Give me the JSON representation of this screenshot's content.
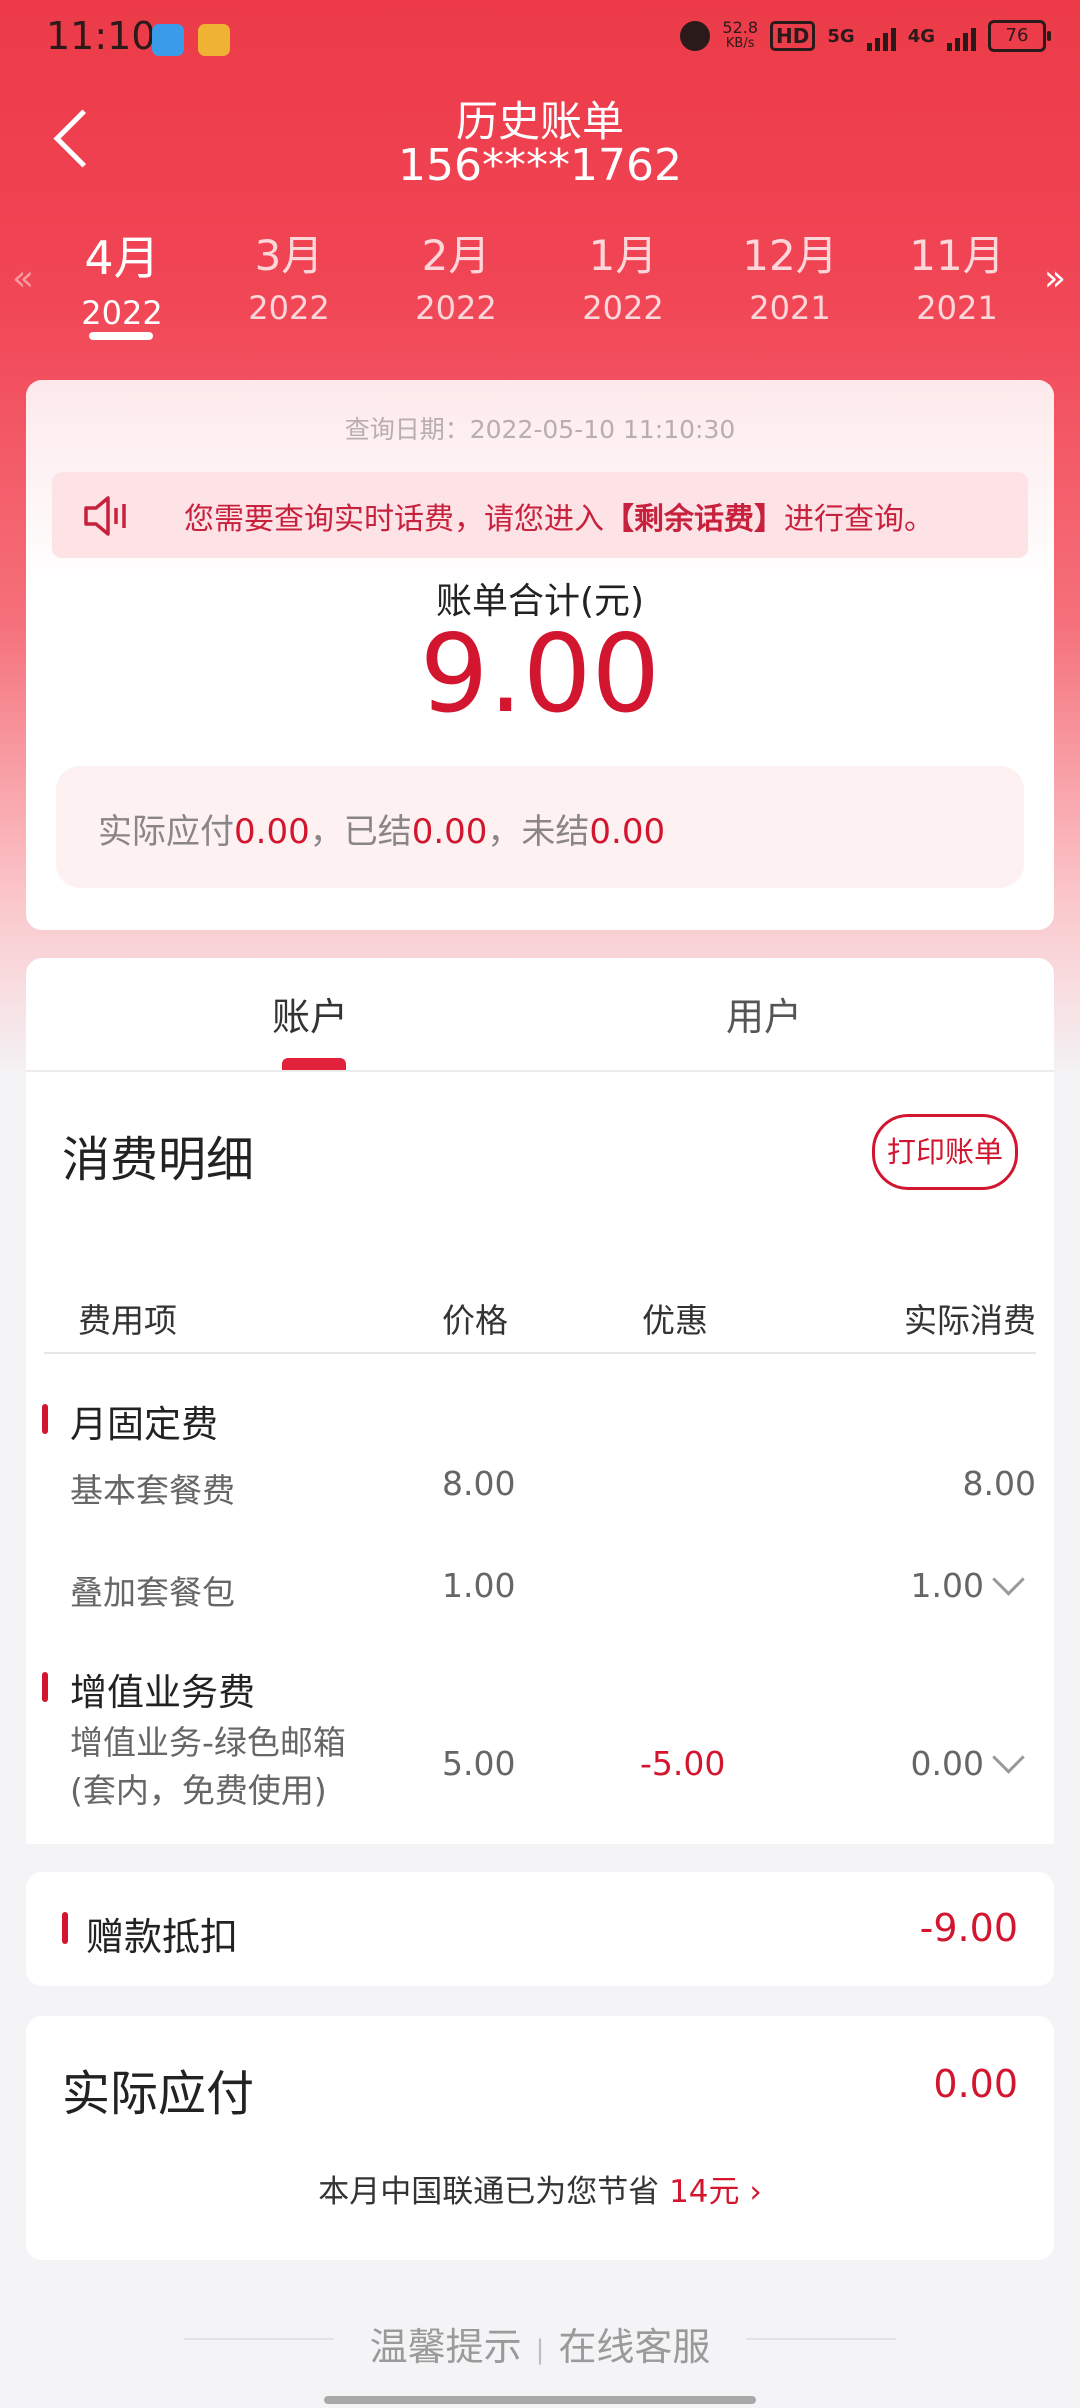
{
  "status_bar": {
    "time": "11:10",
    "net_speed_value": "52.8",
    "net_speed_unit": "KB/s",
    "hd_badge": "HD",
    "sim1_net": "5G",
    "sim2_net": "4G",
    "battery": "76"
  },
  "header": {
    "title": "历史账单",
    "phone": "156****1762"
  },
  "month_tabs": [
    {
      "month": "4月",
      "year": "2022",
      "active": true
    },
    {
      "month": "3月",
      "year": "2022"
    },
    {
      "month": "2月",
      "year": "2022"
    },
    {
      "month": "1月",
      "year": "2022"
    },
    {
      "month": "12月",
      "year": "2021"
    },
    {
      "month": "11月",
      "year": "2021"
    }
  ],
  "summary": {
    "query_date": "查询日期：2022-05-10 11:10:30",
    "notice_prefix": "您需要查询实时话费，请您进入",
    "notice_link": "【剩余话费】",
    "notice_suffix": "进行查询。",
    "total_label": "账单合计(元)",
    "total_value": "9.00",
    "actual_due_label": "实际应付",
    "actual_due_value": "0.00",
    "settled_label": "，已结",
    "settled_value": "0.00",
    "unsettled_label": "，未结",
    "unsettled_value": "0.00"
  },
  "account_tabs": {
    "account": "账户",
    "user": "用户"
  },
  "detail": {
    "title": "消费明细",
    "print_button": "打印账单",
    "columns": [
      "费用项",
      "价格",
      "优惠",
      "实际消费"
    ],
    "sections": [
      {
        "label": "月固定费",
        "rows": [
          {
            "item": "基本套餐费",
            "price": "8.00",
            "discount": "",
            "actual": "8.00"
          },
          {
            "item": "叠加套餐包",
            "price": "1.00",
            "discount": "",
            "actual": "1.00"
          }
        ]
      },
      {
        "label": "增值业务费",
        "rows": [
          {
            "item": "增值业务-绿色邮箱",
            "item_note": "(套内，免费使用)",
            "price": "5.00",
            "discount": "-5.00",
            "actual": "0.00"
          }
        ]
      }
    ]
  },
  "deduction": {
    "label": "赠款抵扣",
    "value": "-9.00"
  },
  "actual_pay": {
    "label": "实际应付",
    "value": "0.00",
    "saving_prefix": "本月中国联通已为您节省",
    "saving_amount": "14元",
    "saving_arrow": "›"
  },
  "footer": {
    "tips": "温馨提示",
    "separator": "|",
    "service": "在线客服"
  },
  "colors": {
    "brand_red": "#d3162f",
    "header_red": "#ec3a48"
  }
}
